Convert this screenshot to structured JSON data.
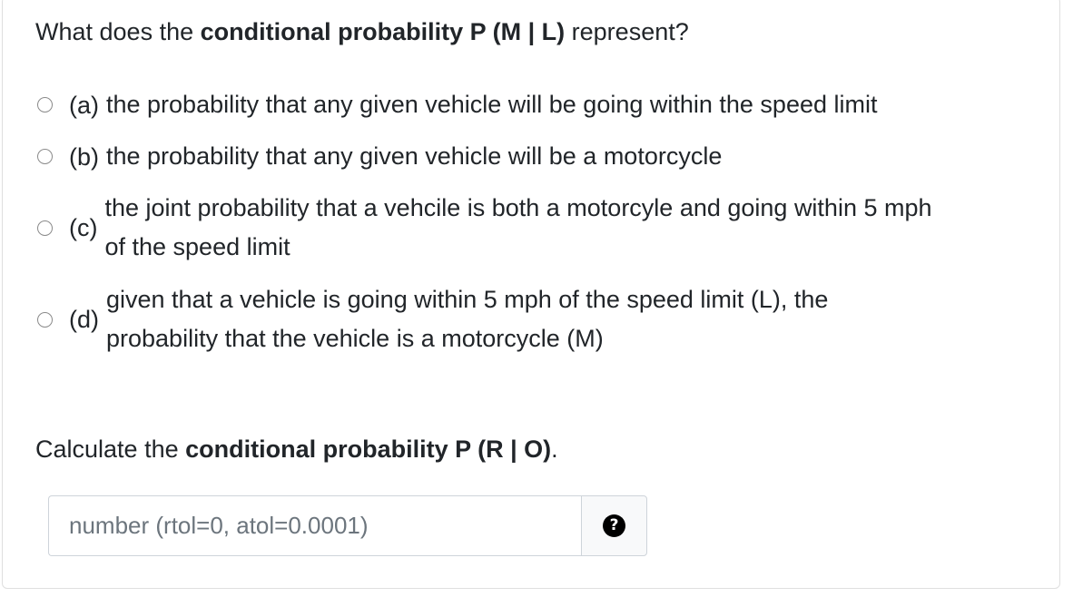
{
  "question1": {
    "prefix": "What does the ",
    "bold": "conditional probability P (M | L)",
    "suffix": " represent?"
  },
  "options": [
    {
      "letter": "(a)",
      "text": "the probability that any given vehicle will be going within the speed limit"
    },
    {
      "letter": "(b)",
      "text": "the probability that any given vehicle will be a motorcycle"
    },
    {
      "letter": "(c)",
      "line1": "the joint probability that a vehcile is both a motorcyle and going within 5 mph",
      "line2": "of the speed limit"
    },
    {
      "letter": "(d)",
      "line1": "given that a vehicle is going within 5 mph of the speed limit (L), the",
      "line2": "probability that the vehicle is a motorcycle (M)"
    }
  ],
  "question2": {
    "prefix": "Calculate the ",
    "bold": "conditional probability P (R | O)",
    "suffix": "."
  },
  "answer_input": {
    "value": "",
    "placeholder": "number (rtol=0, atol=0.0001)"
  },
  "help_button": {
    "icon": "question-circle-icon",
    "glyph": "?"
  }
}
